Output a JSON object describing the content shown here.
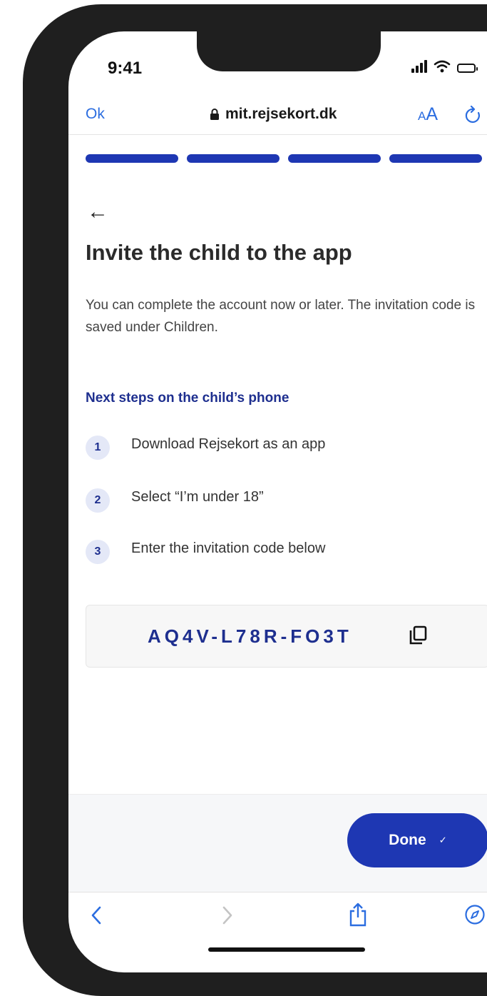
{
  "status_bar": {
    "time": "9:41"
  },
  "browser": {
    "ok_label": "Ok",
    "url": "mit.rejsekort.dk",
    "text_size_small": "A",
    "text_size_large": "A"
  },
  "progress": {
    "steps_total": 4,
    "steps_completed": 4,
    "active_color": "#1e37b3"
  },
  "page": {
    "title": "Invite the child to the app",
    "subtitle": "You can complete the account now or later. The invitation code is saved under Children.",
    "steps_heading": "Next steps on the child’s phone",
    "steps": [
      {
        "number": "1",
        "text": "Download Rejsekort as an app"
      },
      {
        "number": "2",
        "text": "Select “I’m under 18”"
      },
      {
        "number": "3",
        "text": "Enter the invitation code below"
      }
    ],
    "invitation_code": "AQ4V-L78R-FO3T"
  },
  "footer": {
    "done_label": "Done",
    "done_icon": "✓"
  },
  "colors": {
    "brand": "#1e37b3",
    "heading_accent": "#1e2f8f",
    "safari_link": "#2b6de0"
  }
}
